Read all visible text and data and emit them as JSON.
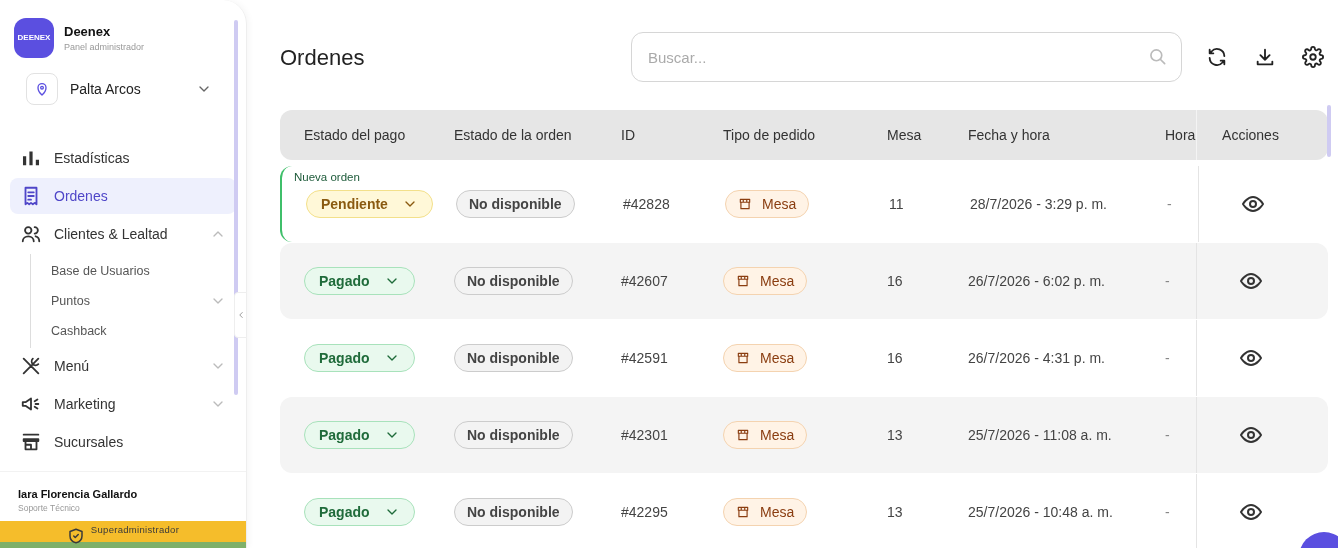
{
  "sidebar": {
    "brand": {
      "name": "Deenex",
      "subtitle": "Panel administrador",
      "logo_text": "DEENEX"
    },
    "location": {
      "label": "Palta Arcos"
    },
    "items": [
      {
        "label": "Estadísticas",
        "selected": false
      },
      {
        "label": "Ordenes",
        "selected": true
      },
      {
        "label": "Clientes & Lealtad",
        "selected": false,
        "expanded": true,
        "children": [
          {
            "label": "Base de Usuarios"
          },
          {
            "label": "Puntos",
            "expanded": false
          },
          {
            "label": "Cashback"
          }
        ]
      },
      {
        "label": "Menú",
        "selected": false,
        "expanded": false
      },
      {
        "label": "Marketing",
        "selected": false,
        "expanded": false
      },
      {
        "label": "Sucursales",
        "selected": false
      }
    ],
    "user": {
      "name": "Iara Florencia Gallardo",
      "role": "Soporte Técnico"
    },
    "role_badge": "Superadministrador"
  },
  "page": {
    "title": "Ordenes",
    "search": {
      "placeholder": "Buscar..."
    }
  },
  "table": {
    "columns": [
      "Estado del pago",
      "Estado de la orden",
      "ID",
      "Tipo de pedido",
      "Mesa",
      "Fecha y hora",
      "Hora",
      "Acciones"
    ],
    "rows": [
      {
        "new_label": "Nueva orden",
        "payment": {
          "label": "Pendiente",
          "kind": "pending"
        },
        "order_status": "No disponible",
        "id": "#42828",
        "type": "Mesa",
        "table": "11",
        "datetime": "28/7/2026 - 3:29 p. m.",
        "time": "-"
      },
      {
        "payment": {
          "label": "Pagado",
          "kind": "paid"
        },
        "order_status": "No disponible",
        "id": "#42607",
        "type": "Mesa",
        "table": "16",
        "datetime": "26/7/2026 - 6:02 p. m.",
        "time": "-"
      },
      {
        "payment": {
          "label": "Pagado",
          "kind": "paid"
        },
        "order_status": "No disponible",
        "id": "#42591",
        "type": "Mesa",
        "table": "16",
        "datetime": "26/7/2026 - 4:31 p. m.",
        "time": "-"
      },
      {
        "payment": {
          "label": "Pagado",
          "kind": "paid"
        },
        "order_status": "No disponible",
        "id": "#42301",
        "type": "Mesa",
        "table": "13",
        "datetime": "25/7/2026 - 11:08 a. m.",
        "time": "-"
      },
      {
        "payment": {
          "label": "Pagado",
          "kind": "paid"
        },
        "order_status": "No disponible",
        "id": "#42295",
        "type": "Mesa",
        "table": "13",
        "datetime": "25/7/2026 - 10:48 a. m.",
        "time": "-"
      }
    ]
  }
}
